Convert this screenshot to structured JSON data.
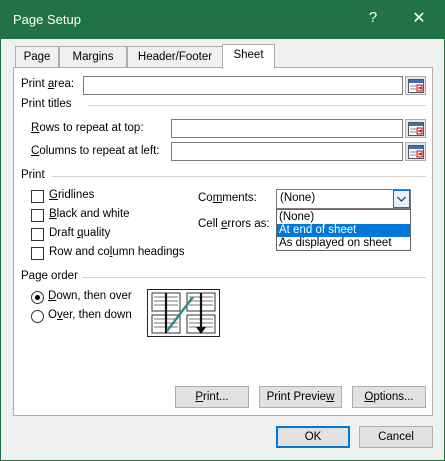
{
  "window": {
    "title": "Page Setup",
    "help_glyph": "?",
    "close_glyph": "✕"
  },
  "tabs": [
    {
      "label": "Page"
    },
    {
      "label": "Margins"
    },
    {
      "label": "Header/Footer"
    },
    {
      "label": "Sheet",
      "active": true
    }
  ],
  "print_area": {
    "label_pre": "Print ",
    "label_u": "a",
    "label_post": "rea:",
    "value": ""
  },
  "print_titles": {
    "heading": "Print titles",
    "rows": {
      "label_u": "R",
      "label_post": "ows to repeat at top:",
      "value": ""
    },
    "cols": {
      "label_u": "C",
      "label_post": "olumns to repeat at left:",
      "value": ""
    }
  },
  "print": {
    "heading": "Print",
    "gridlines": {
      "label_u": "G",
      "label_post": "ridlines",
      "checked": false
    },
    "black_white": {
      "label_u": "B",
      "label_post": "lack and white",
      "checked": false
    },
    "draft": {
      "label_pre": "Draft ",
      "label_u": "q",
      "label_post": "uality",
      "checked": false
    },
    "headings": {
      "label_pre": "Row and co",
      "label_u": "l",
      "label_post": "umn headings",
      "checked": false
    },
    "comments": {
      "label_pre": "Co",
      "label_u": "m",
      "label_post": "ments:",
      "value": "(None)",
      "options": [
        "(None)",
        "At end of sheet",
        "As displayed on sheet"
      ],
      "highlighted_index": 1
    },
    "cell_errors": {
      "label_pre": "Cell ",
      "label_u": "e",
      "label_post": "rrors as:"
    }
  },
  "page_order": {
    "heading": "Page order",
    "down_over": {
      "label_u": "D",
      "label_post": "own, then over",
      "checked": true
    },
    "over_down": {
      "label_pre": "O",
      "label_u": "v",
      "label_post": "er, then down",
      "checked": false
    }
  },
  "buttons": {
    "print": {
      "label_pre": "",
      "label_u": "P",
      "label_post": "rint..."
    },
    "preview": {
      "label_pre": "Print Previe",
      "label_u": "w",
      "label_post": ""
    },
    "options": {
      "label_pre": "",
      "label_u": "O",
      "label_post": "ptions..."
    },
    "ok": "OK",
    "cancel": "Cancel"
  },
  "colors": {
    "titlebar": "#217346",
    "selection": "#0078d7"
  },
  "icons": {
    "collapse_dialog": "collapse-dialog-icon",
    "dropdown_arrow": "chevron-down-icon"
  }
}
